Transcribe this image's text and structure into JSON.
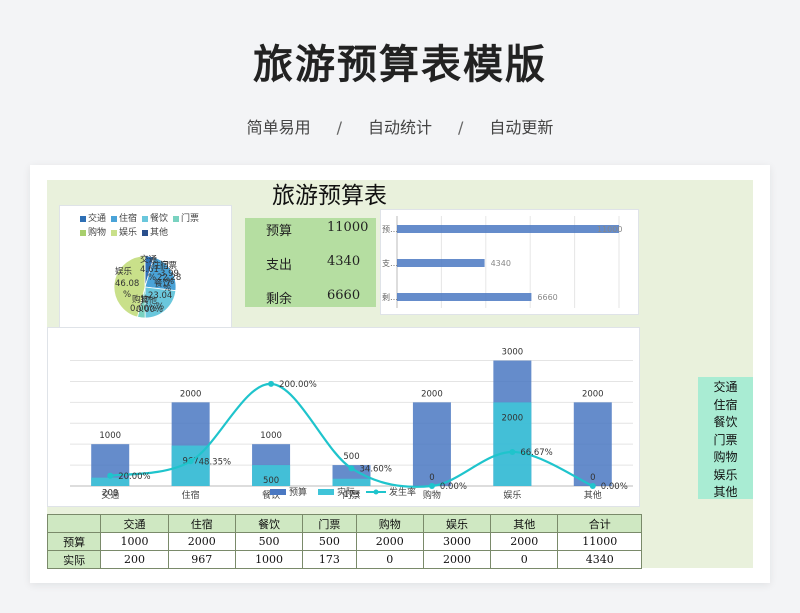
{
  "header": {
    "title": "旅游预算表模版",
    "features": [
      "简单易用",
      "自动统计",
      "自动更新"
    ],
    "separator": "/"
  },
  "sheet": {
    "title": "旅游预算表",
    "summary": [
      {
        "label": "预算",
        "value": "11000"
      },
      {
        "label": "支出",
        "value": "4340"
      },
      {
        "label": "剩余",
        "value": "6660"
      }
    ],
    "category_list": [
      "交通",
      "住宿",
      "餐饮",
      "门票",
      "购物",
      "娱乐",
      "其他"
    ]
  },
  "colors": {
    "budget_bar": "#4a78c2",
    "actual_bar": "#3fc4d8",
    "rate_line": "#1fc4cc",
    "summary_bg": "#b5dea1",
    "sheet_bg": "#e9f1dc",
    "category_bg": "#a9ecd3"
  },
  "table": {
    "headers": [
      "",
      "交通",
      "住宿",
      "餐饮",
      "门票",
      "购物",
      "娱乐",
      "其他",
      "合计"
    ],
    "rows": [
      [
        "预算",
        "1000",
        "2000",
        "500",
        "500",
        "2000",
        "3000",
        "2000",
        "11000"
      ],
      [
        "实际",
        "200",
        "967",
        "1000",
        "173",
        "0",
        "2000",
        "0",
        "4340"
      ]
    ]
  },
  "chart_data": [
    {
      "type": "pie",
      "legend": [
        "交通",
        "住宿",
        "餐饮",
        "门票",
        "购物",
        "娱乐",
        "其他"
      ],
      "legend_colors": [
        "#2e6fb5",
        "#4aa3d8",
        "#6ac7dc",
        "#79d2c0",
        "#a8cf6d",
        "#c9e08a",
        "#2b4f8c"
      ],
      "slices": [
        {
          "label": "交通",
          "value": 4.61,
          "color": "#2e6fb5"
        },
        {
          "label": "住宿",
          "value": 22.28,
          "color": "#4aa3d8"
        },
        {
          "label": "餐饮",
          "value": 23.04,
          "color": "#6ac7dc"
        },
        {
          "label": "门票",
          "value": 3.99,
          "color": "#79d2c0"
        },
        {
          "label": "购物",
          "value": 0.0,
          "color": "#a8cf6d"
        },
        {
          "label": "娱乐",
          "value": 46.08,
          "color": "#c9e08a"
        },
        {
          "label": "其他",
          "value": 0.0,
          "color": "#2b4f8c"
        }
      ],
      "data_labels": [
        "娱乐",
        "46.08",
        "%",
        "住宿",
        "22.28",
        "%",
        "餐饮",
        "23.04",
        "%",
        "交通",
        "4.61",
        "%",
        "购物",
        "0.00%",
        "其他",
        "0.00%",
        "门票",
        "3.99",
        "%"
      ]
    },
    {
      "type": "bar",
      "orientation": "horizontal",
      "categories": [
        "预…",
        "支…",
        "剩…"
      ],
      "values": [
        11000,
        4340,
        6660
      ],
      "xlim": [
        0,
        11000
      ]
    },
    {
      "type": "bar",
      "categories": [
        "交通",
        "住宿",
        "餐饮",
        "门票",
        "购物",
        "娱乐",
        "其他"
      ],
      "series": [
        {
          "name": "预算",
          "values": [
            1000,
            2000,
            1000,
            500,
            2000,
            3000,
            2000
          ]
        },
        {
          "name": "实际",
          "values": [
            200,
            967,
            500,
            173,
            0,
            2000,
            0
          ]
        },
        {
          "name": "发生率",
          "type": "line",
          "values": [
            20.0,
            48.35,
            200.0,
            34.6,
            0.0,
            66.67,
            0.0
          ],
          "labels": [
            "20.00%",
            "48.35%",
            "200.00%",
            "34.60%",
            "0.00%",
            "66.67%",
            "0.00%"
          ]
        }
      ],
      "ylim": [
        0,
        3300
      ],
      "legend": "bottom",
      "grid": true
    }
  ]
}
